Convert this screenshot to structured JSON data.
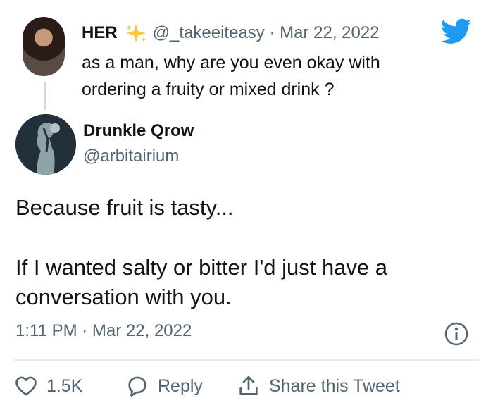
{
  "reply_to": {
    "name": "HER",
    "meta": "@_takeeiteasy · Mar 22, 2022",
    "text": "as a man, why are you even okay with ordering a fruity or mixed drink ?"
  },
  "tweet": {
    "name": "Drunkle Qrow",
    "handle": "@arbitairium",
    "lines": [
      "Because fruit is tasty...",
      "If I wanted salty or bitter I'd just have a",
      "conversation with you."
    ],
    "timestamp": "1:11 PM · Mar 22, 2022"
  },
  "actions": {
    "like_count": "1.5K",
    "reply_label": "Reply",
    "share_label": "Share this Tweet"
  },
  "colors": {
    "twitter_blue": "#1d9bf0",
    "sparkle": "#f5c64a",
    "secondary_text": "#536471"
  },
  "icons": [
    "twitter-bird-icon",
    "sparkle-icon",
    "info-icon",
    "heart-icon",
    "reply-icon",
    "share-icon"
  ]
}
